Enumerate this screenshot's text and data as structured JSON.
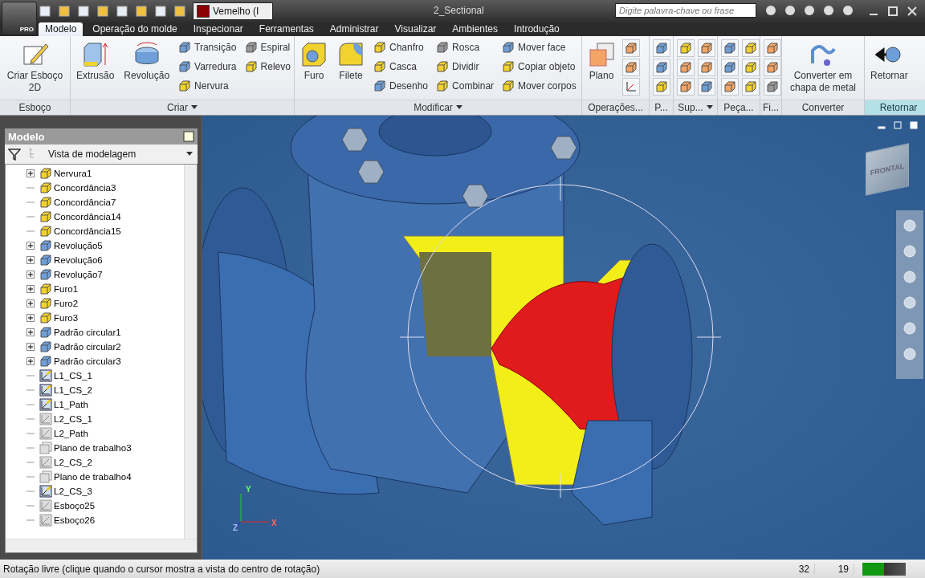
{
  "app_button": {
    "label": "PRO"
  },
  "quick_access": {
    "material": {
      "value": "Vemelho (I",
      "color": "#8b0000"
    }
  },
  "window": {
    "title": "2_Sectional"
  },
  "search": {
    "placeholder": "Digite palavra-chave ou frase"
  },
  "tabs": [
    {
      "label": "Modelo",
      "selected": true
    },
    {
      "label": "Operação do molde",
      "selected": false
    },
    {
      "label": "Inspecionar",
      "selected": false
    },
    {
      "label": "Ferramentas",
      "selected": false
    },
    {
      "label": "Administrar",
      "selected": false
    },
    {
      "label": "Visualizar",
      "selected": false
    },
    {
      "label": "Ambientes",
      "selected": false
    },
    {
      "label": "Introdução",
      "selected": false
    }
  ],
  "ribbon": {
    "panels": [
      {
        "label": "Esboço",
        "has_menu": false,
        "selected": false,
        "large": [
          {
            "label": "Criar Esboço 2D",
            "kind": "sketch"
          }
        ]
      },
      {
        "label": "Criar",
        "has_menu": true,
        "selected": false,
        "large": [
          {
            "label": "Extrusão",
            "kind": "extrude"
          },
          {
            "label": "Revolução",
            "kind": "revolve"
          }
        ],
        "small": [
          {
            "label": "Transição",
            "kind": "blue"
          },
          {
            "label": "Varredura",
            "kind": "blue"
          },
          {
            "label": "Nervura",
            "kind": "yellow"
          },
          {
            "label": "Espiral",
            "kind": "grey"
          },
          {
            "label": "Relevo",
            "kind": "yellow"
          }
        ]
      },
      {
        "label": "Modificar",
        "has_menu": true,
        "selected": false,
        "large": [
          {
            "label": "Furo",
            "kind": "hole"
          },
          {
            "label": "Filete",
            "kind": "fillet"
          }
        ],
        "small": [
          {
            "label": "Chanfro",
            "kind": "yellow"
          },
          {
            "label": "Casca",
            "kind": "yellow"
          },
          {
            "label": "Desenho",
            "kind": "blue"
          },
          {
            "label": "Rosca",
            "kind": "grey"
          },
          {
            "label": "Dividir",
            "kind": "yellow"
          },
          {
            "label": "Combinar",
            "kind": "yellow"
          },
          {
            "label": "Mover face",
            "kind": "blue"
          },
          {
            "label": "Copiar objeto",
            "kind": "yellow"
          },
          {
            "label": "Mover corpos",
            "kind": "yellow"
          }
        ]
      },
      {
        "label": "Operações...",
        "has_menu": false,
        "selected": false,
        "large": [
          {
            "label": "Plano",
            "kind": "plane"
          }
        ],
        "icons": [
          {
            "kind": "orange"
          },
          {
            "kind": "orange"
          },
          {
            "kind": "axis"
          }
        ]
      },
      {
        "label": "P...",
        "has_menu": false,
        "selected": false,
        "icons": [
          {
            "kind": "blue"
          },
          {
            "kind": "blue"
          },
          {
            "kind": "yellow"
          }
        ]
      },
      {
        "label": "Sup...",
        "has_menu": true,
        "selected": false,
        "icons": [
          {
            "kind": "yellow"
          },
          {
            "kind": "orange"
          },
          {
            "kind": "orange"
          },
          {
            "kind": "orange"
          },
          {
            "kind": "orange"
          },
          {
            "kind": "blue"
          }
        ]
      },
      {
        "label": "Peça...",
        "has_menu": false,
        "selected": false,
        "icons": [
          {
            "kind": "blue"
          },
          {
            "kind": "blue"
          },
          {
            "kind": "orange"
          },
          {
            "kind": "yellow"
          },
          {
            "kind": "yellow"
          },
          {
            "kind": "yellow"
          }
        ]
      },
      {
        "label": "Fi...",
        "has_menu": false,
        "selected": false,
        "icons": [
          {
            "kind": "orange"
          },
          {
            "kind": "orange"
          },
          {
            "kind": "grey"
          }
        ]
      },
      {
        "label": "Converter",
        "has_menu": false,
        "selected": false,
        "large": [
          {
            "label": "Converter em chapa de metal",
            "kind": "sheet"
          }
        ]
      },
      {
        "label": "Retornar",
        "has_menu": false,
        "selected": true,
        "large": [
          {
            "label": "Retornar",
            "kind": "return"
          }
        ]
      }
    ]
  },
  "browser": {
    "title": "Modelo",
    "view": "Vista de modelagem",
    "items": [
      {
        "label": "Nervura1",
        "expandable": true,
        "kind": "rib"
      },
      {
        "label": "Concordância3",
        "expandable": false,
        "kind": "fillet"
      },
      {
        "label": "Concordância7",
        "expandable": false,
        "kind": "fillet"
      },
      {
        "label": "Concordância14",
        "expandable": false,
        "kind": "fillet"
      },
      {
        "label": "Concordância15",
        "expandable": false,
        "kind": "fillet"
      },
      {
        "label": "Revolução5",
        "expandable": true,
        "kind": "revolve"
      },
      {
        "label": "Revolução6",
        "expandable": true,
        "kind": "revolve"
      },
      {
        "label": "Revolução7",
        "expandable": true,
        "kind": "revolve"
      },
      {
        "label": "Furo1",
        "expandable": true,
        "kind": "hole"
      },
      {
        "label": "Furo2",
        "expandable": true,
        "kind": "hole"
      },
      {
        "label": "Furo3",
        "expandable": true,
        "kind": "hole"
      },
      {
        "label": "Padrão circular1",
        "expandable": true,
        "kind": "pattern"
      },
      {
        "label": "Padrão circular2",
        "expandable": true,
        "kind": "pattern"
      },
      {
        "label": "Padrão circular3",
        "expandable": true,
        "kind": "pattern"
      },
      {
        "label": "L1_CS_1",
        "expandable": false,
        "kind": "sketch"
      },
      {
        "label": "L1_CS_2",
        "expandable": false,
        "kind": "sketch"
      },
      {
        "label": "L1_Path",
        "expandable": false,
        "kind": "sketch"
      },
      {
        "label": "L2_CS_1",
        "expandable": false,
        "kind": "sketch_off"
      },
      {
        "label": "L2_Path",
        "expandable": false,
        "kind": "sketch_off"
      },
      {
        "label": "Plano de trabalho3",
        "expandable": false,
        "kind": "plane"
      },
      {
        "label": "L2_CS_2",
        "expandable": false,
        "kind": "sketch_off"
      },
      {
        "label": "Plano de trabalho4",
        "expandable": false,
        "kind": "plane"
      },
      {
        "label": "L2_CS_3",
        "expandable": false,
        "kind": "sketch"
      },
      {
        "label": "Esboço25",
        "expandable": false,
        "kind": "sketch_off"
      },
      {
        "label": "Esboço26",
        "expandable": false,
        "kind": "sketch_off"
      }
    ]
  },
  "viewport": {
    "view_cube": "FRONTAL",
    "axes": [
      "X",
      "Y",
      "Z"
    ]
  },
  "status_bar": {
    "message": "Rotação livre (clique quando o cursor mostra a vista do centro de rotação)",
    "values": [
      "32",
      "19"
    ],
    "memory": {
      "level": 0.5
    }
  }
}
